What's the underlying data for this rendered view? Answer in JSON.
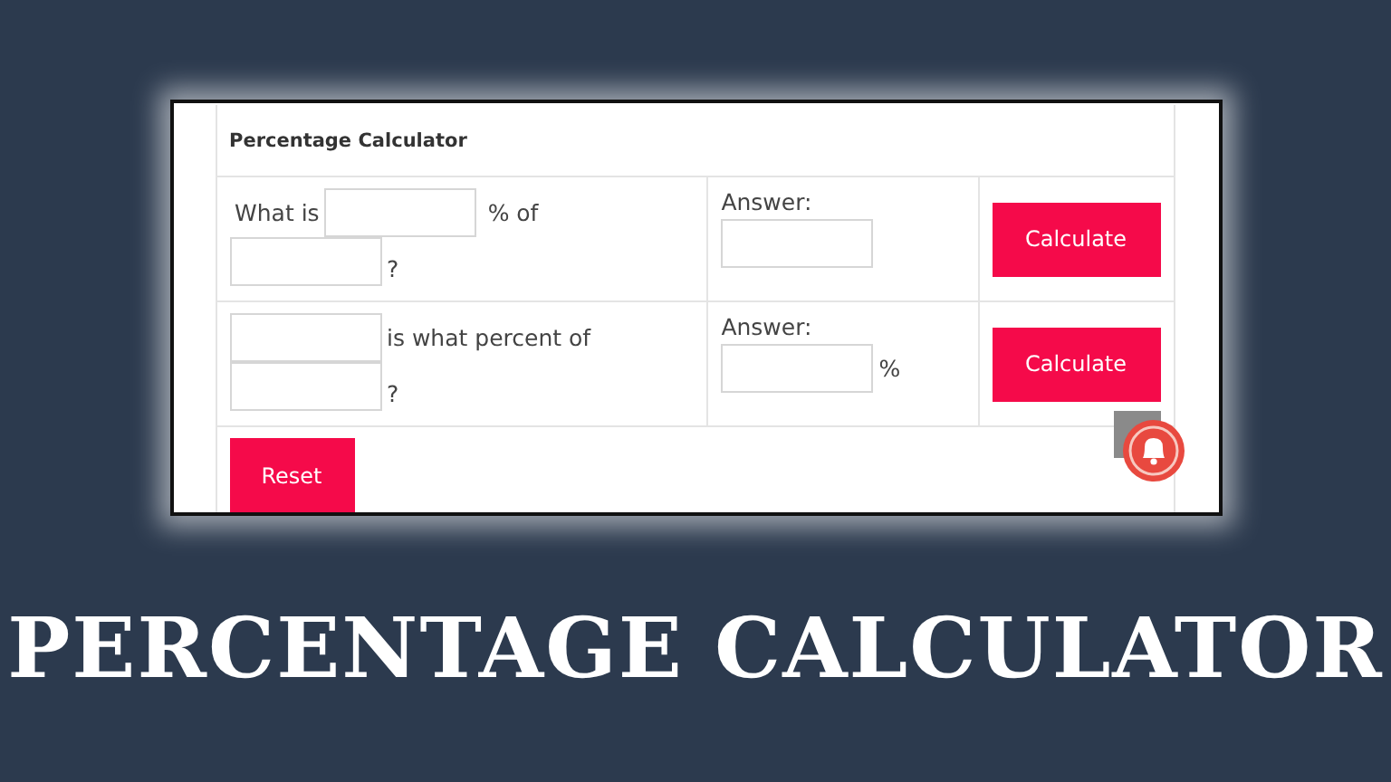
{
  "calculator": {
    "heading": "Percentage Calculator",
    "rows": [
      {
        "kind": "what-is",
        "prefix": "What is",
        "middle": "% of",
        "suffix": "?",
        "answer_label": "Answer:",
        "button": "Calculate"
      },
      {
        "kind": "is-what-percent",
        "middle": "is what percent of",
        "suffix": "?",
        "answer_label": "Answer:",
        "answer_unit": "%",
        "button": "Calculate"
      }
    ],
    "reset": "Reset"
  },
  "banner": "PERCENTAGE CALCULATOR"
}
